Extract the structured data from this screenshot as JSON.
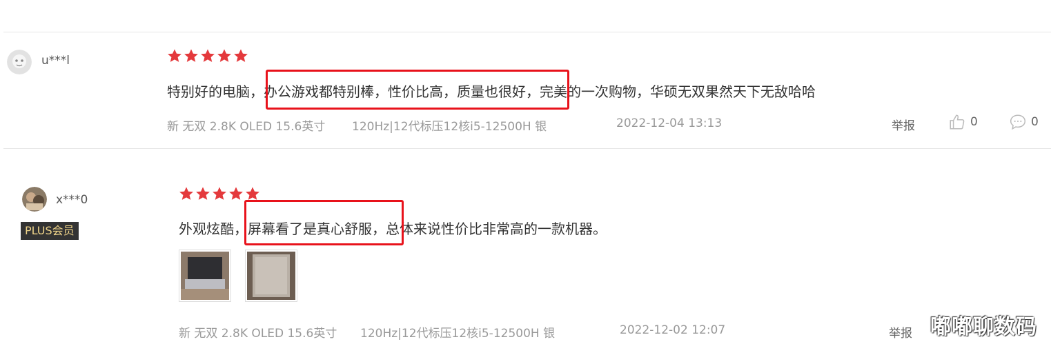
{
  "reviews": [
    {
      "username": "u***l",
      "rating": 5,
      "text_before": "特别好的电脑，",
      "text_highlight": "办公游戏都特别棒，性价比高，质量也很好，",
      "text_after": "完美的一次购物，华硕无双果然天下无敌哈哈",
      "product": "新 无双 2.8K OLED 15.6英寸",
      "spec": "120Hz|12代标压12核i5-12500H 银",
      "date": "2022-12-04 13:13",
      "report_label": "举报",
      "likes": "0",
      "comments": "0"
    },
    {
      "username": "x***0",
      "badge": "PLUS会员",
      "rating": 5,
      "text_before": "外观炫酷，",
      "text_highlight": "屏幕看了是真心舒服，",
      "text_after": "总体来说性价比非常高的一款机器。",
      "product": "新 无双 2.8K OLED 15.6英寸",
      "spec": "120Hz|12代标压12核i5-12500H 银",
      "date": "2022-12-02 12:07",
      "report_label": "举报"
    }
  ],
  "watermark": "嘟嘟聊数码",
  "colors": {
    "star": "#e4393c",
    "highlight_box": "#e8121b",
    "meta_text": "#999999",
    "badge_bg": "#333333",
    "badge_text": "#f0d58a"
  }
}
